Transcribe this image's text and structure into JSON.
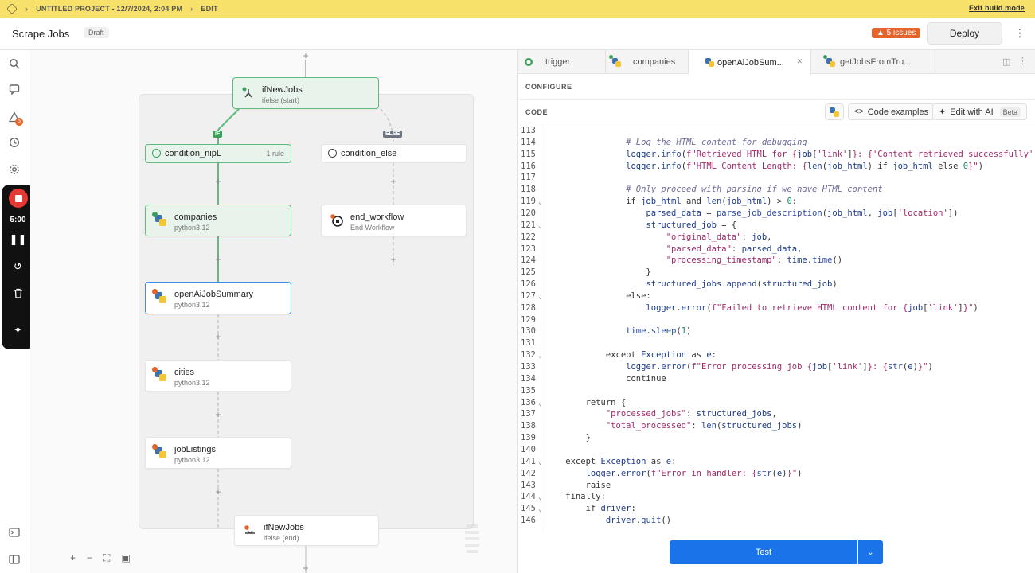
{
  "topbar": {
    "project": "UNTITLED PROJECT - 12/7/2024, 2:04 PM",
    "mode": "EDIT",
    "exit": "Exit build mode"
  },
  "header": {
    "title": "Scrape Jobs",
    "draft": "Draft",
    "issues": "▲ 5 issues",
    "deploy": "Deploy"
  },
  "recorder": {
    "time": "5:00"
  },
  "sidebar_badge": "5",
  "nodes": {
    "ifNewJobs": {
      "name": "ifNewJobs",
      "sub": "ifelse (start)"
    },
    "condition_nipL": {
      "name": "condition_nipL",
      "rule": "1 rule"
    },
    "condition_else": {
      "name": "condition_else"
    },
    "companies": {
      "name": "companies",
      "sub": "python3.12"
    },
    "end_workflow": {
      "name": "end_workflow",
      "sub": "End Workflow"
    },
    "openAiJobSummary": {
      "name": "openAiJobSummary",
      "sub": "python3.12"
    },
    "cities": {
      "name": "cities",
      "sub": "python3.12"
    },
    "jobListings": {
      "name": "jobListings",
      "sub": "python3.12"
    },
    "ifNewJobsEnd": {
      "name": "ifNewJobs",
      "sub": "ifelse (end)"
    },
    "if_tag": "IF",
    "else_tag": "ELSE"
  },
  "tabs": [
    {
      "label": "trigger"
    },
    {
      "label": "companies"
    },
    {
      "label": "openAiJobSum..."
    },
    {
      "label": "getJobsFromTru..."
    }
  ],
  "panel": {
    "configure": "CONFIGURE",
    "code": "CODE",
    "code_examples": "Code examples",
    "edit_ai": "Edit with AI",
    "beta": "Beta",
    "test": "Test"
  },
  "code_lines": [
    {
      "n": "113",
      "fold": "",
      "html": ""
    },
    {
      "n": "114",
      "fold": "",
      "html": "                <span class='cmt'># Log the HTML content for debugging</span>"
    },
    {
      "n": "115",
      "fold": "",
      "html": "                <span class='var'>logger</span>.<span class='fn'>info</span>(<span class='str'>f\"Retrieved HTML for {</span><span class='var'>job</span>[<span class='str'>'link'</span>]<span class='str'>}: {</span><span class='str'>'Content retrieved successfully'</span>"
    },
    {
      "n": "116",
      "fold": "",
      "html": "                <span class='var'>logger</span>.<span class='fn'>info</span>(<span class='str'>f\"HTML Content Length: {</span><span class='fn'>len</span>(<span class='var'>job_html</span>) if <span class='var'>job_html</span> else <span class='num'>0</span><span class='str'>}\"</span>)"
    },
    {
      "n": "117",
      "fold": "",
      "html": ""
    },
    {
      "n": "118",
      "fold": "",
      "html": "                <span class='cmt'># Only proceed with parsing if we have HTML content</span>"
    },
    {
      "n": "119",
      "fold": "⌄",
      "html": "                if <span class='var'>job_html</span> and <span class='fn'>len</span>(<span class='var'>job_html</span>) &gt; <span class='num'>0</span>:"
    },
    {
      "n": "120",
      "fold": "",
      "html": "                    <span class='var'>parsed_data</span> = <span class='fn'>parse_job_description</span>(<span class='var'>job_html</span>, <span class='var'>job</span>[<span class='str'>'location'</span>])"
    },
    {
      "n": "121",
      "fold": "⌄",
      "html": "                    <span class='var'>structured_job</span> = {"
    },
    {
      "n": "122",
      "fold": "",
      "html": "                        <span class='str'>\"original_data\"</span>: <span class='var'>job</span>,"
    },
    {
      "n": "123",
      "fold": "",
      "html": "                        <span class='str'>\"parsed_data\"</span>: <span class='var'>parsed_data</span>,"
    },
    {
      "n": "124",
      "fold": "",
      "html": "                        <span class='str'>\"processing_timestamp\"</span>: <span class='var'>time</span>.<span class='fn'>time</span>()"
    },
    {
      "n": "125",
      "fold": "",
      "html": "                    }"
    },
    {
      "n": "126",
      "fold": "",
      "html": "                    <span class='var'>structured_jobs</span>.<span class='fn'>append</span>(<span class='var'>structured_job</span>)"
    },
    {
      "n": "127",
      "fold": "⌄",
      "html": "                else:"
    },
    {
      "n": "128",
      "fold": "",
      "html": "                    <span class='var'>logger</span>.<span class='fn'>error</span>(<span class='str'>f\"Failed to retrieve HTML content for {</span><span class='var'>job</span>[<span class='str'>'link'</span>]<span class='str'>}\"</span>)"
    },
    {
      "n": "129",
      "fold": "",
      "html": ""
    },
    {
      "n": "130",
      "fold": "",
      "html": "                <span class='var'>time</span>.<span class='fn'>sleep</span>(<span class='num'>1</span>)"
    },
    {
      "n": "131",
      "fold": "",
      "html": ""
    },
    {
      "n": "132",
      "fold": "⌄",
      "html": "            except <span class='var'>Exception</span> as <span class='var'>e</span>:"
    },
    {
      "n": "133",
      "fold": "",
      "html": "                <span class='var'>logger</span>.<span class='fn'>error</span>(<span class='str'>f\"Error processing job {</span><span class='var'>job</span>[<span class='str'>'link'</span>]<span class='str'>}: {</span><span class='fn'>str</span>(<span class='var'>e</span>)<span class='str'>}\"</span>)"
    },
    {
      "n": "134",
      "fold": "",
      "html": "                continue"
    },
    {
      "n": "135",
      "fold": "",
      "html": ""
    },
    {
      "n": "136",
      "fold": "⌄",
      "html": "        return {"
    },
    {
      "n": "137",
      "fold": "",
      "html": "            <span class='str'>\"processed_jobs\"</span>: <span class='var'>structured_jobs</span>,"
    },
    {
      "n": "138",
      "fold": "",
      "html": "            <span class='str'>\"total_processed\"</span>: <span class='fn'>len</span>(<span class='var'>structured_jobs</span>)"
    },
    {
      "n": "139",
      "fold": "",
      "html": "        }"
    },
    {
      "n": "140",
      "fold": "",
      "html": ""
    },
    {
      "n": "141",
      "fold": "⌄",
      "html": "    except <span class='var'>Exception</span> as <span class='var'>e</span>:"
    },
    {
      "n": "142",
      "fold": "",
      "html": "        <span class='var'>logger</span>.<span class='fn'>error</span>(<span class='str'>f\"Error in handler: {</span><span class='fn'>str</span>(<span class='var'>e</span>)<span class='str'>}\"</span>)"
    },
    {
      "n": "143",
      "fold": "",
      "html": "        raise"
    },
    {
      "n": "144",
      "fold": "⌄",
      "html": "    finally:"
    },
    {
      "n": "145",
      "fold": "⌄",
      "html": "        if <span class='var'>driver</span>:"
    },
    {
      "n": "146",
      "fold": "",
      "html": "            <span class='var'>driver</span>.<span class='fn'>quit</span>()"
    }
  ]
}
